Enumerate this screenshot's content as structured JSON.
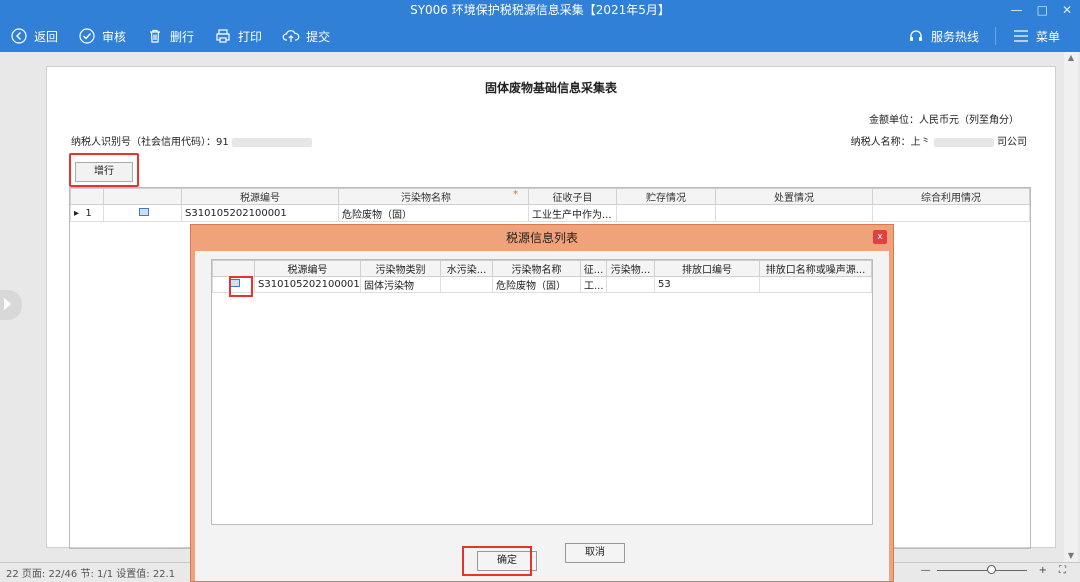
{
  "window": {
    "title": "SY006 环境保护税税源信息采集【2021年5月】",
    "minimize": "—",
    "maximize": "□",
    "close": "✕"
  },
  "toolbar": {
    "back": "返回",
    "review": "审核",
    "delete_row": "删行",
    "print": "打印",
    "submit": "提交",
    "hotline": "服务热线",
    "menu": "菜单"
  },
  "doc": {
    "title": "固体废物基础信息采集表",
    "unit": "金额单位：人民币元（列至角分）",
    "taxpayer_id_label": "纳税人识别号（社会信用代码）：91",
    "taxpayer_name_label": "纳税人名称：上⺀",
    "taxpayer_name_suffix": "司公司",
    "add_row": "增行"
  },
  "main_grid": {
    "columns": [
      "",
      "",
      "税源编号",
      "污染物名称",
      "征收子目",
      "贮存情况",
      "处置情况",
      "综合利用情况"
    ],
    "required_mark": "*",
    "rows": [
      {
        "pointer": "▸",
        "index": "1",
        "code": "S310105202100001",
        "pollutant": "危险废物（固）",
        "subitem": "工业生产中作为...",
        "storage": "",
        "disposal": "",
        "reuse": ""
      }
    ]
  },
  "dialog": {
    "title": "税源信息列表",
    "close": "x",
    "columns": [
      "",
      "税源编号",
      "污染物类别",
      "水污染...",
      "污染物名称",
      "征...",
      "污染物...",
      "排放口编号",
      "排放口名称或噪声源..."
    ],
    "rows": [
      {
        "code": "S310105202100001",
        "category": "固体污染物",
        "water": "",
        "name": "危险废物（固）",
        "levy": "工...",
        "pollutant": "",
        "outlet_no": "53",
        "outlet_name": ""
      }
    ],
    "confirm": "确定",
    "cancel": "取消"
  },
  "statusbar": {
    "left": "22  页面: 22/46   节: 1/1   设置值: 22.1",
    "zoom_minus": "—",
    "zoom_plus": "+"
  },
  "colors": {
    "brand": "#2f80d6",
    "dialog_frame": "#f0a27a",
    "highlight": "#e8322d"
  }
}
